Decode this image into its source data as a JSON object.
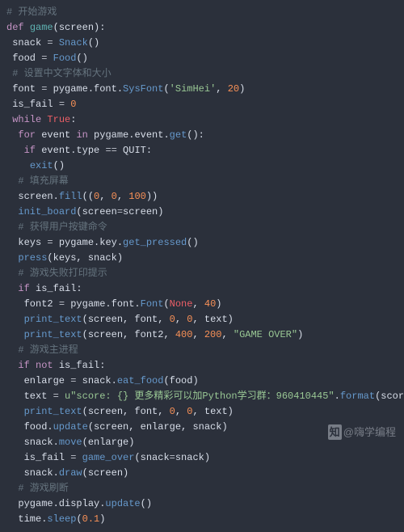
{
  "watermark": {
    "logo": "知",
    "text": "@嗨学编程"
  },
  "lines": [
    [
      [
        "c",
        "# 开始游戏"
      ]
    ],
    [
      [
        "kw",
        "def "
      ],
      [
        "fn",
        "game"
      ],
      [
        "id",
        "(screen):"
      ]
    ],
    [
      [
        "id",
        " snack "
      ],
      [
        "op",
        "= "
      ],
      [
        "call",
        "Snack"
      ],
      [
        "id",
        "()"
      ]
    ],
    [
      [
        "id",
        " food "
      ],
      [
        "op",
        "= "
      ],
      [
        "call",
        "Food"
      ],
      [
        "id",
        "()"
      ]
    ],
    [
      [
        "c",
        " # 设置中文字体和大小"
      ]
    ],
    [
      [
        "id",
        " font "
      ],
      [
        "op",
        "= "
      ],
      [
        "id",
        "pygame.font."
      ],
      [
        "call",
        "SysFont"
      ],
      [
        "id",
        "("
      ],
      [
        "str",
        "'SimHei'"
      ],
      [
        "id",
        ", "
      ],
      [
        "num",
        "20"
      ],
      [
        "id",
        ")"
      ]
    ],
    [
      [
        "id",
        " is_fail "
      ],
      [
        "op",
        "= "
      ],
      [
        "num",
        "0"
      ]
    ],
    [
      [
        "kw",
        " while "
      ],
      [
        "const",
        "True"
      ],
      [
        "id",
        ":"
      ]
    ],
    [
      [
        "kw",
        "  for "
      ],
      [
        "id",
        "event "
      ],
      [
        "kw",
        "in "
      ],
      [
        "id",
        "pygame.event."
      ],
      [
        "call",
        "get"
      ],
      [
        "id",
        "():"
      ]
    ],
    [
      [
        "kw",
        "   if "
      ],
      [
        "id",
        "event.type "
      ],
      [
        "op",
        "== "
      ],
      [
        "id",
        "QUIT:"
      ]
    ],
    [
      [
        "id",
        "    "
      ],
      [
        "call",
        "exit"
      ],
      [
        "id",
        "()"
      ]
    ],
    [
      [
        "c",
        "  # 填充屏幕"
      ]
    ],
    [
      [
        "id",
        "  screen."
      ],
      [
        "call",
        "fill"
      ],
      [
        "id",
        "(("
      ],
      [
        "num",
        "0"
      ],
      [
        "id",
        ", "
      ],
      [
        "num",
        "0"
      ],
      [
        "id",
        ", "
      ],
      [
        "num",
        "100"
      ],
      [
        "id",
        "))"
      ]
    ],
    [
      [
        "id",
        "  "
      ],
      [
        "call",
        "init_board"
      ],
      [
        "id",
        "(screen"
      ],
      [
        "op",
        "="
      ],
      [
        "id",
        "screen)"
      ]
    ],
    [
      [
        "c",
        "  # 获得用户按键命令"
      ]
    ],
    [
      [
        "id",
        "  keys "
      ],
      [
        "op",
        "= "
      ],
      [
        "id",
        "pygame.key."
      ],
      [
        "call",
        "get_pressed"
      ],
      [
        "id",
        "()"
      ]
    ],
    [
      [
        "id",
        "  "
      ],
      [
        "call",
        "press"
      ],
      [
        "id",
        "(keys, snack)"
      ]
    ],
    [
      [
        "c",
        "  # 游戏失败打印提示"
      ]
    ],
    [
      [
        "kw",
        "  if "
      ],
      [
        "id",
        "is_fail:"
      ]
    ],
    [
      [
        "id",
        "   font2 "
      ],
      [
        "op",
        "= "
      ],
      [
        "id",
        "pygame.font."
      ],
      [
        "call",
        "Font"
      ],
      [
        "id",
        "("
      ],
      [
        "const",
        "None"
      ],
      [
        "id",
        ", "
      ],
      [
        "num",
        "40"
      ],
      [
        "id",
        ")"
      ]
    ],
    [
      [
        "id",
        "   "
      ],
      [
        "call",
        "print_text"
      ],
      [
        "id",
        "(screen, font, "
      ],
      [
        "num",
        "0"
      ],
      [
        "id",
        ", "
      ],
      [
        "num",
        "0"
      ],
      [
        "id",
        ", text)"
      ]
    ],
    [
      [
        "id",
        "   "
      ],
      [
        "call",
        "print_text"
      ],
      [
        "id",
        "(screen, font2, "
      ],
      [
        "num",
        "400"
      ],
      [
        "id",
        ", "
      ],
      [
        "num",
        "200"
      ],
      [
        "id",
        ", "
      ],
      [
        "str",
        "\"GAME OVER\""
      ],
      [
        "id",
        ")"
      ]
    ],
    [
      [
        "c",
        "  # 游戏主进程"
      ]
    ],
    [
      [
        "kw",
        "  if not "
      ],
      [
        "id",
        "is_fail:"
      ]
    ],
    [
      [
        "id",
        "   enlarge "
      ],
      [
        "op",
        "= "
      ],
      [
        "id",
        "snack."
      ],
      [
        "call",
        "eat_food"
      ],
      [
        "id",
        "(food)"
      ]
    ],
    [
      [
        "id",
        "   text "
      ],
      [
        "op",
        "= "
      ],
      [
        "str",
        "u\"score: {} 更多精彩可以加Python学习群：960410445\""
      ],
      [
        "id",
        "."
      ],
      [
        "call",
        "format"
      ],
      [
        "id",
        "(score)"
      ]
    ],
    [
      [
        "id",
        "   "
      ],
      [
        "call",
        "print_text"
      ],
      [
        "id",
        "(screen, font, "
      ],
      [
        "num",
        "0"
      ],
      [
        "id",
        ", "
      ],
      [
        "num",
        "0"
      ],
      [
        "id",
        ", text)"
      ]
    ],
    [
      [
        "id",
        "   food."
      ],
      [
        "call",
        "update"
      ],
      [
        "id",
        "(screen, enlarge, snack)"
      ]
    ],
    [
      [
        "id",
        "   snack."
      ],
      [
        "call",
        "move"
      ],
      [
        "id",
        "(enlarge)"
      ]
    ],
    [
      [
        "id",
        "   is_fail "
      ],
      [
        "op",
        "= "
      ],
      [
        "call",
        "game_over"
      ],
      [
        "id",
        "(snack"
      ],
      [
        "op",
        "="
      ],
      [
        "id",
        "snack)"
      ]
    ],
    [
      [
        "id",
        "   snack."
      ],
      [
        "call",
        "draw"
      ],
      [
        "id",
        "(screen)"
      ]
    ],
    [
      [
        "c",
        "  # 游戏刷断"
      ]
    ],
    [
      [
        "id",
        "  pygame.display."
      ],
      [
        "call",
        "update"
      ],
      [
        "id",
        "()"
      ]
    ],
    [
      [
        "id",
        "  time."
      ],
      [
        "call",
        "sleep"
      ],
      [
        "id",
        "("
      ],
      [
        "num",
        "0.1"
      ],
      [
        "id",
        ")"
      ]
    ]
  ]
}
